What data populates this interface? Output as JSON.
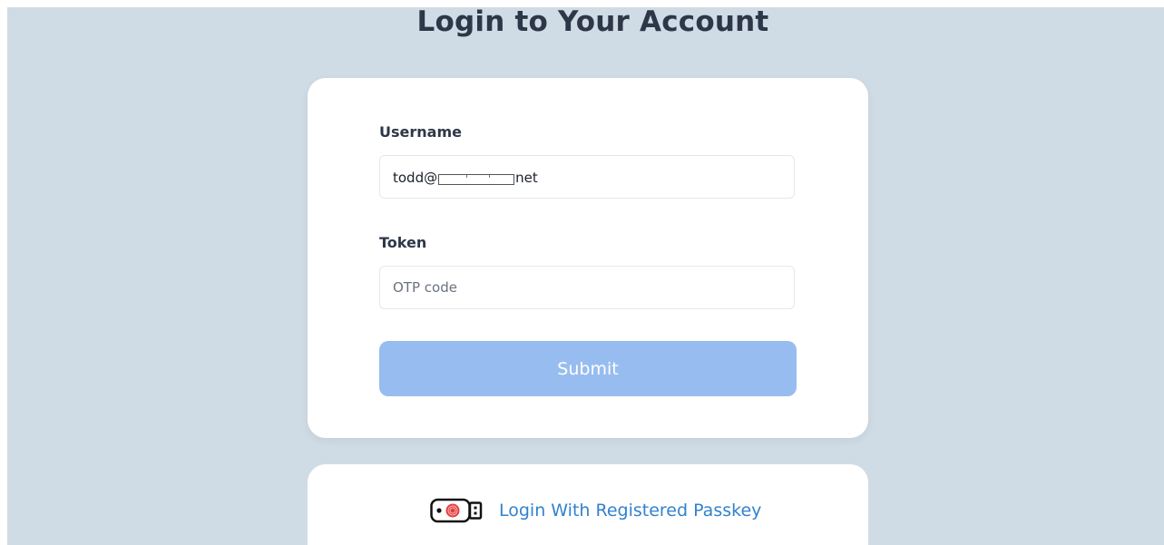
{
  "header": {
    "title": "Login to Your Account"
  },
  "login_form": {
    "username_label": "Username",
    "username_value_prefix": "todd@",
    "username_value_suffix": "net",
    "token_label": "Token",
    "token_placeholder": "OTP code",
    "token_value": "",
    "submit_label": "Submit"
  },
  "passkey": {
    "label": "Login With Registered Passkey",
    "icon": "usb-security-key-icon"
  },
  "colors": {
    "page_background": "#cfdce6",
    "card_background": "#ffffff",
    "heading": "#2d3748",
    "submit_button": "#97bdf0",
    "link": "#3182ce"
  }
}
